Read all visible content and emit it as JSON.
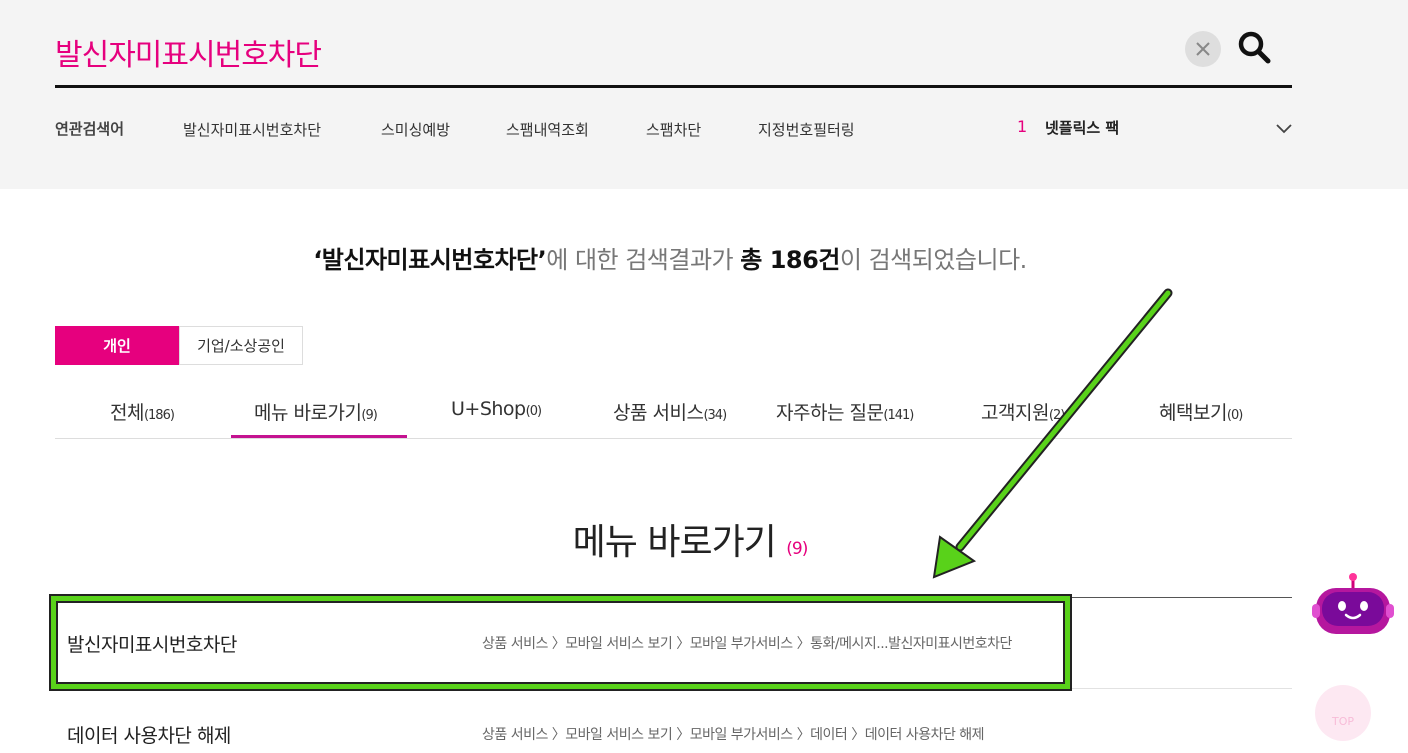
{
  "search": {
    "query": "발신자미표시번호차단"
  },
  "related": {
    "label": "연관검색어",
    "items": [
      "발신자미표시번호차단",
      "스미싱예방",
      "스팸내역조회",
      "스팸차단",
      "지정번호필터링"
    ],
    "rank_number": "1",
    "rank_text": "넷플릭스 팩"
  },
  "summary": {
    "query_quoted": "‘발신자미표시번호차단’",
    "middle": "에 대한 검색결과가 ",
    "total_label": "총 186건",
    "tail": "이 검색되었습니다."
  },
  "segments": [
    {
      "label": "개인",
      "active": true
    },
    {
      "label": "기업/소상공인",
      "active": false
    }
  ],
  "categories": [
    {
      "label": "전체",
      "count": "(186)"
    },
    {
      "label": "메뉴 바로가기",
      "count": "(9)"
    },
    {
      "label": "U+Shop",
      "count": "(0)"
    },
    {
      "label": "상품 서비스",
      "count": "(34)"
    },
    {
      "label": "자주하는 질문",
      "count": "(141)"
    },
    {
      "label": "고객지원",
      "count": "(2)"
    },
    {
      "label": "혜택보기",
      "count": "(0)"
    }
  ],
  "section": {
    "title": "메뉴 바로가기",
    "count": "(9)"
  },
  "menu_items": [
    {
      "name": "발신자미표시번호차단",
      "path": "상품 서비스 〉모바일 서비스 보기 〉모바일 부가서비스 〉통화/메시지...발신자미표시번호차단"
    },
    {
      "name": "데이터 사용차단 해제",
      "path": "상품 서비스 〉모바일 서비스 보기 〉모바일 부가서비스 〉데이터 〉데이터 사용차단 해제"
    }
  ],
  "floating": {
    "top_label": "TOP"
  },
  "colors": {
    "brand": "#e6007e",
    "highlight": "#59d21a",
    "tab_underline": "#c41290"
  }
}
